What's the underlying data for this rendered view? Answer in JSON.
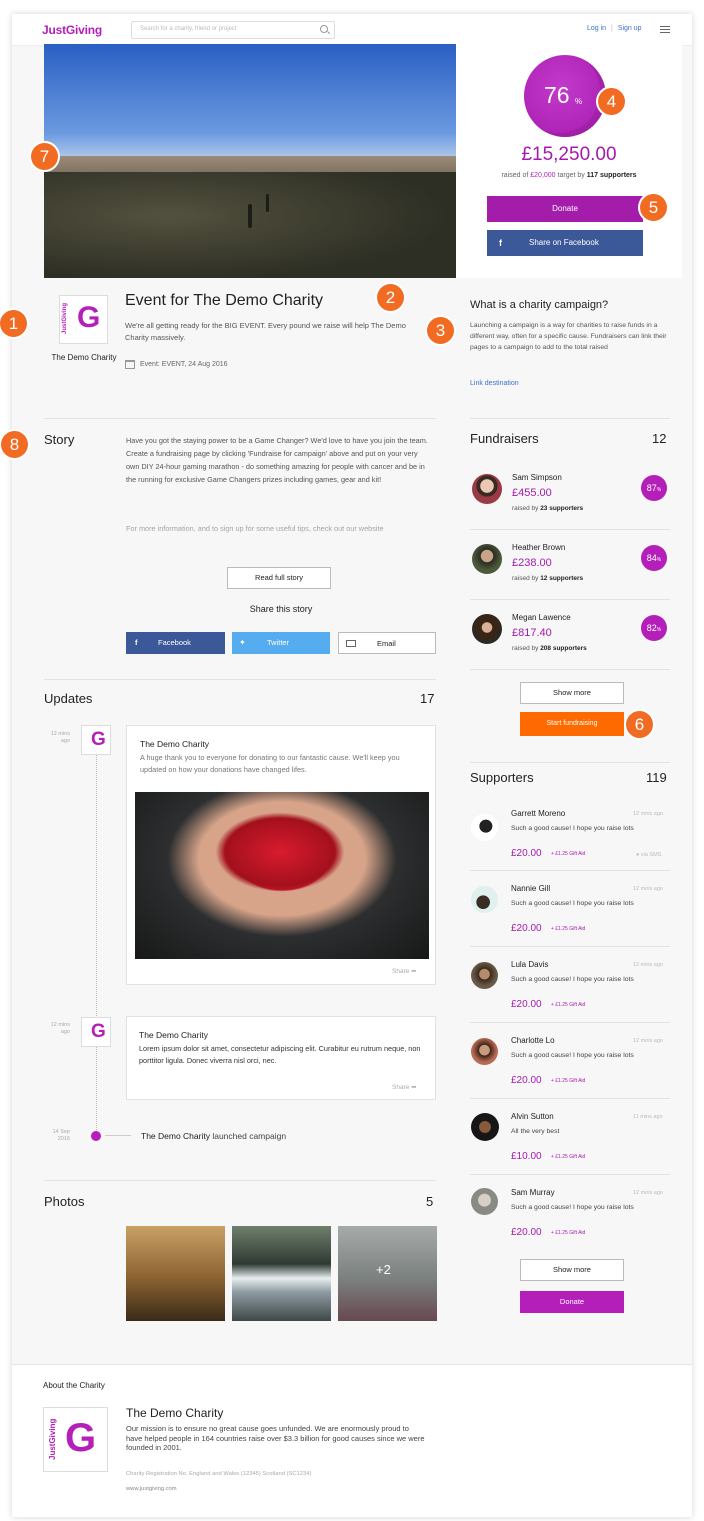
{
  "header": {
    "logo": "JustGiving",
    "search_placeholder": "Search for a charity, friend or project",
    "login": "Log in",
    "separator": "|",
    "signup": "Sign up"
  },
  "progress": {
    "percent": "76",
    "percent_symbol": "%",
    "raised": "£15,250.00",
    "raised_of": "raised of",
    "target": "£20,000",
    "target_by": "target by",
    "supporters": "117 supporters",
    "donate": "Donate",
    "share_facebook": "Share on Facebook"
  },
  "badges": [
    "1",
    "2",
    "3",
    "4",
    "5",
    "6",
    "7",
    "8"
  ],
  "event": {
    "logo_side": "JustGiving",
    "logo_letter": "G",
    "charity_name": "The Demo Charity",
    "title": "Event for The Demo Charity",
    "description": "We're all getting ready for the BIG EVENT. Every pound we raise will help The Demo Charity massively.",
    "date": "Event: EVENT, 24 Aug 2016"
  },
  "campaign_info": {
    "title": "What is a charity campaign?",
    "text": "Launching a campaign is a way for charities to raise funds in a different way, often for a specific cause. Fundraisers can link their pages to a campaign to add to the total raised",
    "link": "Link destination"
  },
  "story": {
    "title": "Story",
    "p1": "Have you got the staying power to be a Game Changer? We'd love to have you join the team. Create a fundraising page by clicking 'Fundraise for campaign' above and put on your very own DIY 24-hour gaming marathon - do something amazing for people with cancer and be in the running for exclusive Game Changers prizes including games, gear and kit!",
    "p2": "For more information, and to sign up for some useful tips, check out our website",
    "read_full": "Read full story",
    "share_title": "Share this story",
    "facebook": "Facebook",
    "twitter": "Twitter",
    "email": "Email"
  },
  "fundraisers": {
    "title": "Fundraisers",
    "count": "12",
    "raised_by": "raised by",
    "items": [
      {
        "name": "Sam Simpson",
        "amount": "£455.00",
        "supporters": "23 supporters",
        "pct": "87"
      },
      {
        "name": "Heather Brown",
        "amount": "£238.00",
        "supporters": "12 supporters",
        "pct": "84"
      },
      {
        "name": "Megan Lawence",
        "amount": "£817.40",
        "supporters": "208 supporters",
        "pct": "82"
      }
    ],
    "pct_symbol": "%",
    "show_more": "Show more",
    "start_fundraising": "Start fundraising"
  },
  "updates": {
    "title": "Updates",
    "count": "17",
    "items": [
      {
        "time": "12 mins ago",
        "author": "The Demo Charity",
        "text": "A huge thank you to everyone for donating to our fantastic cause. We'll keep you updated on how your donations have changed lifes.",
        "share": "Share"
      },
      {
        "time": "12 mins ago",
        "author": "The Demo Charity",
        "text": "Lorem ipsum dolor sit amet, consectetur adipiscing elit. Curabitur eu rutrum neque, non porttitor ligula. Donec viverra nisl orci, nec.",
        "share": "Share"
      }
    ],
    "launch_time": "14 Sep 2016",
    "launch_author": "The Demo Charity",
    "launch_text": "launched campaign"
  },
  "supporters": {
    "title": "Supporters",
    "count": "119",
    "items": [
      {
        "name": "Garrett Moreno",
        "time": "12 mins ago",
        "msg": "Such a good cause! I hope you raise lots",
        "amount": "£20.00",
        "gift": "+ £1.25 Gift Aid",
        "via": "via SMS"
      },
      {
        "name": "Nannie Gill",
        "time": "12 mins ago",
        "msg": "Such a good cause! I hope you raise lots",
        "amount": "£20.00",
        "gift": "+ £1.25 Gift Aid"
      },
      {
        "name": "Lula Davis",
        "time": "12 mins ago",
        "msg": "Such a good cause! I hope you raise lots",
        "amount": "£20.00",
        "gift": "+ £1.25 Gift Aid"
      },
      {
        "name": "Charlotte Lo",
        "time": "12 mins ago",
        "msg": "Such a good cause! I hope you raise lots",
        "amount": "£20.00",
        "gift": "+ £1.25 Gift Aid"
      },
      {
        "name": "Alvin Sutton",
        "time": "11 mins ago",
        "msg": "All the very best",
        "amount": "£10.00",
        "gift": "+ £1.25 Gift Aid"
      },
      {
        "name": "Sam Murray",
        "time": "12 mins ago",
        "msg": "Such a good cause! I hope you raise lots",
        "amount": "£20.00",
        "gift": "+ £1.25 Gift Aid"
      }
    ],
    "show_more": "Show more",
    "donate": "Donate"
  },
  "photos": {
    "title": "Photos",
    "count": "5",
    "more": "+2"
  },
  "about": {
    "heading": "About the Charity",
    "name": "The Demo Charity",
    "text": "Our mission is to ensure no great cause goes unfunded. We are enormously proud to have helped people in 164 countries raise over $3.3 billion for good causes since we were founded in 2001.",
    "registration": "Charity Registration No. England and Wales (12345) Scotland (SC1234)",
    "website": "www.justgiving.com"
  },
  "colors": {
    "brand": "#b31fb8",
    "accent_orange": "#ff6a00",
    "facebook": "#3b5998",
    "twitter": "#55acee"
  }
}
